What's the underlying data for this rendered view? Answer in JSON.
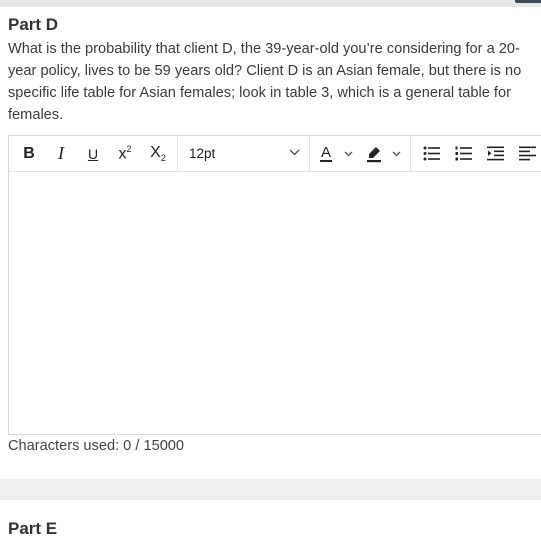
{
  "part_d": {
    "title": "Part D",
    "question": "What is the probability that client D, the 39-year-old you’re considering for a 20-year policy, lives to be 59 years old? Client D is an Asian female, but there is no specific life table for Asian females; look in table 3, which is a general table for females."
  },
  "editor": {
    "font_size_value": "12pt",
    "toolbar_icons": [
      "bold-icon",
      "italic-icon",
      "underline-icon",
      "superscript-icon",
      "subscript-icon",
      "font-color-icon",
      "highlight-icon",
      "bullet-list-icon",
      "numbered-list-icon",
      "indent-icon",
      "align-left-icon"
    ],
    "chars_used": "Characters used: 0 / 15000"
  },
  "part_e": {
    "title": "Part E"
  },
  "colors": {
    "accent_dark": "#3d4a57",
    "text": "#333333",
    "border": "#d7d7d7"
  }
}
